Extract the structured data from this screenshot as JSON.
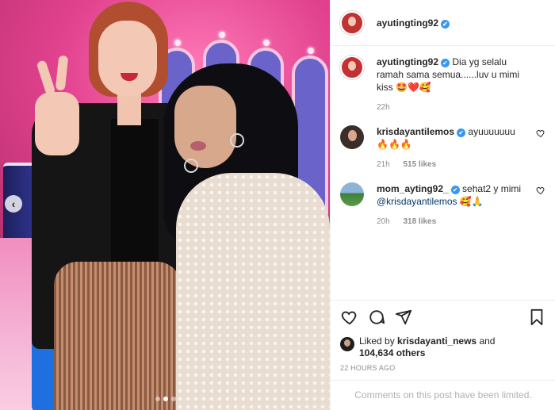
{
  "post": {
    "username": "ayutingting92",
    "verified_badge": "✔"
  },
  "carousel": {
    "prev_icon": "chevron-left-icon",
    "prev_glyph": "‹",
    "slide_count": 3,
    "active_slide": 2
  },
  "comments": [
    {
      "user": "ayutingting92",
      "text": "Dia yg selalu ramah sama semua......luv u mimi kiss 🤩❤️🥰",
      "time": "22h",
      "likes": ""
    },
    {
      "user": "krisdayantilemos",
      "text": "ayuuuuuuu 🔥🔥🔥",
      "time": "21h",
      "likes": "515 likes"
    },
    {
      "user": "mom_ayting92_",
      "text_before": "sehat2 y mimi ",
      "mention": "@krisdayantilemos",
      "text_after": " 🥰🙏",
      "time": "20h",
      "likes": "318 likes"
    }
  ],
  "actions": {
    "like_icon": "heart-icon",
    "comment_icon": "comment-icon",
    "share_icon": "send-icon",
    "save_icon": "bookmark-icon"
  },
  "likes": {
    "prefix": "Liked by",
    "user": "krisdayanti_news",
    "middle": "and",
    "count": "104,634 others"
  },
  "timestamp": "22 HOURS AGO",
  "comments_limited": "Comments on this post have been limited.",
  "colors": {
    "verified": "#3897f0",
    "muted": "#8e8e8e",
    "mention": "#00376b"
  }
}
